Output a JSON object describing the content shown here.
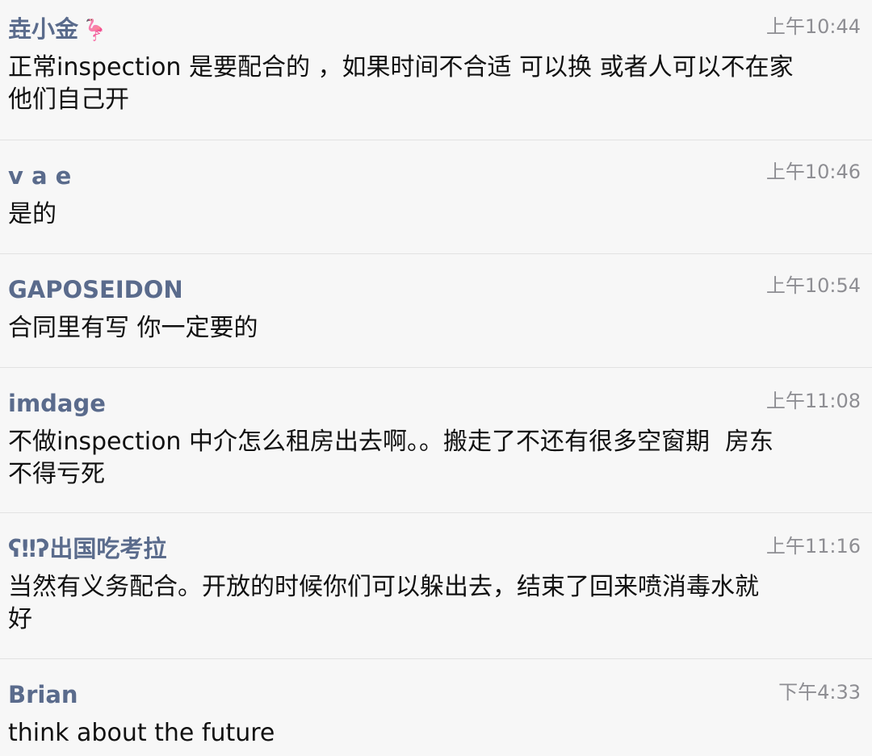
{
  "messages": [
    {
      "name": "垚小金",
      "name_icon": "flamingo-icon",
      "name_emoji": "🦩",
      "time": "上午10:44",
      "text": "正常inspection 是要配合的 ，如果时间不合适 可以换 或者人可以不在家\n他们自己开"
    },
    {
      "name": "v a e",
      "time": "上午10:46",
      "text": "是的"
    },
    {
      "name": "GAPOSEIDON",
      "time": "上午10:54",
      "text": "合同里有写 你一定要的"
    },
    {
      "name": "imdage",
      "time": "上午11:08",
      "text": "不做inspection 中介怎么租房出去啊。。搬走了不还有很多空窗期  房东\n不得亏死"
    },
    {
      "name": "ʕ‼ʔ出国吃考拉",
      "time": "上午11:16",
      "text": "当然有义务配合。开放的时候你们可以躲出去，结束了回来喷消毒水就\n好"
    },
    {
      "name": "Brian",
      "time": "下午4:33",
      "text": "think about the future"
    }
  ]
}
